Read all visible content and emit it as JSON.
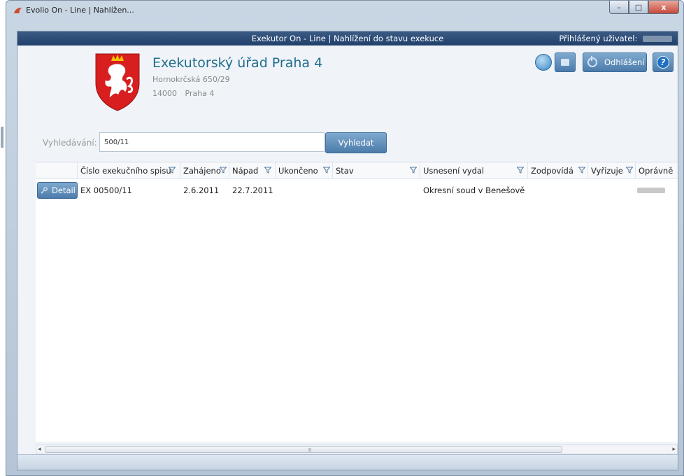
{
  "window": {
    "title": "Evolio On - Line | Nahlížen...",
    "controls": {
      "minimize": "–",
      "maximize": "□",
      "close": "x"
    }
  },
  "header": {
    "title": "Exekutor On - Line | Nahlížení do stavu exekuce",
    "user_label": "Přihlášený uživatel:"
  },
  "office": {
    "name": "Exekutorský úřad Praha 4",
    "street": "Hornokrčská 650/29",
    "zip": "14000",
    "city": "Praha 4"
  },
  "toolbar": {
    "logout_label": "Odhlášení",
    "help_label": "?"
  },
  "search": {
    "label": "Vyhledávání:",
    "value": "500/11",
    "button_label": "Vyhledat"
  },
  "table": {
    "columns": [
      "Číslo exekučního spisu",
      "Zahájeno",
      "Nápad",
      "Ukončeno",
      "Stav",
      "Usnesení vydal",
      "Zodpovídá",
      "Vyřizuje",
      "Oprávně"
    ],
    "rows": [
      {
        "action": "Detail",
        "cislo": "EX 00500/11",
        "zahajeno": "2.6.2011",
        "napad": "22.7.2011",
        "ukonceno": "",
        "stav": "",
        "usneseni": "Okresní soud v Benešově",
        "zodpovida": "",
        "vyrizuje": ""
      }
    ]
  },
  "scrollbar": {
    "grip": "II",
    "left": "◂",
    "right": "▸"
  },
  "colors": {
    "header_bg": "#2a4a76",
    "accent_button": "#5b88b8",
    "office_name": "#1f6d8c"
  }
}
